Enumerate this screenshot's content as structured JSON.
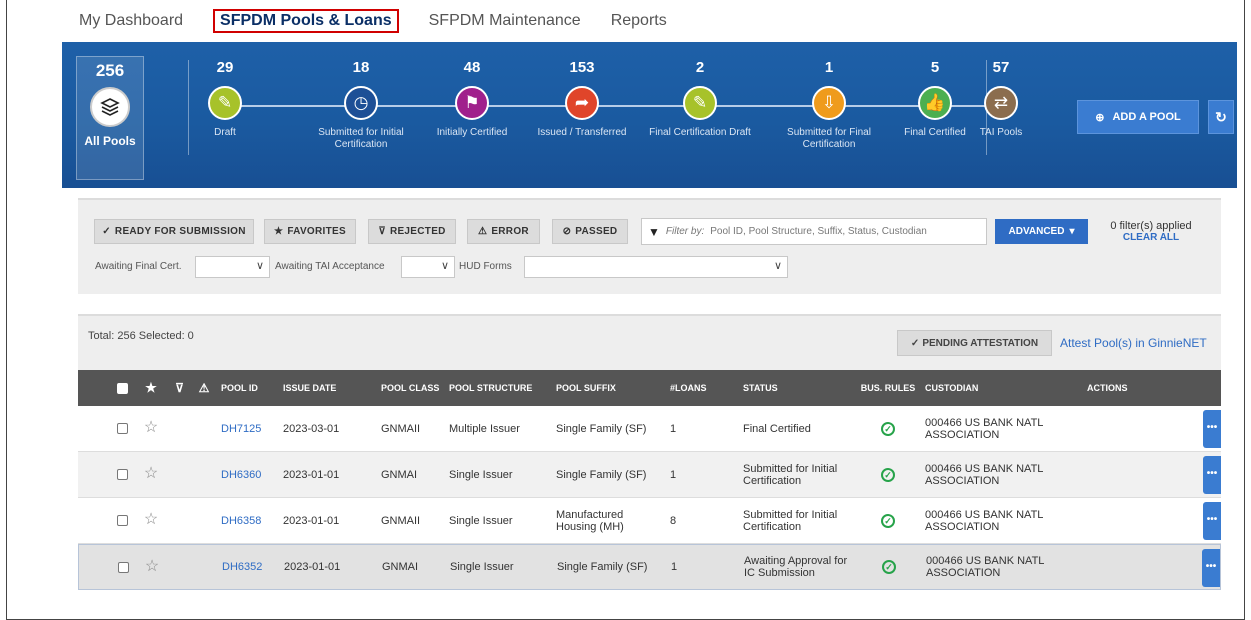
{
  "nav": {
    "tabs": [
      {
        "label": "My Dashboard"
      },
      {
        "label": "SFPDM Pools & Loans",
        "active": true
      },
      {
        "label": "SFPDM Maintenance"
      },
      {
        "label": "Reports"
      }
    ]
  },
  "strip": {
    "all": {
      "count": "256",
      "label": "All Pools"
    },
    "steps": [
      {
        "count": "29",
        "label": "Draft",
        "icon": "edit-icon",
        "color": "#a7c22a"
      },
      {
        "count": "18",
        "label": "Submitted for Initial Certification",
        "icon": "clock-icon",
        "color": "#1d4f96"
      },
      {
        "count": "48",
        "label": "Initially Certified",
        "icon": "flag-icon",
        "color": "#a0208c"
      },
      {
        "count": "153",
        "label": "Issued / Transferred",
        "icon": "share-icon",
        "color": "#e0452a"
      },
      {
        "count": "2",
        "label": "Final Certification Draft",
        "icon": "edit-icon",
        "color": "#a7c22a"
      },
      {
        "count": "1",
        "label": "Submitted for Final Certification",
        "icon": "inbox-icon",
        "color": "#ef9b1c"
      },
      {
        "count": "5",
        "label": "Final Certified",
        "icon": "thumbs-up-icon",
        "color": "#4caf50"
      },
      {
        "count": "57",
        "label": "TAI Pools",
        "icon": "transfer-icon",
        "color": "#8b6d4e"
      }
    ],
    "add_pool_label": "ADD A POOL"
  },
  "filters": {
    "buttons": [
      "READY FOR SUBMISSION",
      "FAVORITES",
      "REJECTED",
      "ERROR",
      "PASSED"
    ],
    "search_prefix": "Filter by:",
    "search_placeholder": "Pool ID, Pool Structure, Suffix, Status, Custodian",
    "advanced_label": "ADVANCED",
    "applied_text": "0 filter(s) applied",
    "clear_all": "CLEAR ALL",
    "awaiting_final_cert": "Awaiting Final Cert.",
    "awaiting_tai": "Awaiting TAI Acceptance",
    "hud_forms": "HUD Forms"
  },
  "summary": {
    "total_text": "Total: 256 Selected: 0",
    "pending_attestation": "PENDING ATTESTATION",
    "attest_link": "Attest Pool(s) in GinnieNET"
  },
  "table": {
    "headers": {
      "pool_id": "POOL ID",
      "issue_date": "ISSUE DATE",
      "pool_class": "POOL CLASS",
      "pool_structure": "POOL STRUCTURE",
      "pool_suffix": "POOL SUFFIX",
      "loans": "#LOANS",
      "status": "STATUS",
      "bus_rules": "BUS. RULES",
      "custodian": "CUSTODIAN",
      "actions": "ACTIONS"
    },
    "rows": [
      {
        "pool_id": "DH7125",
        "issue_date": "2023-03-01",
        "pool_class": "GNMAII",
        "pool_structure": "Multiple Issuer",
        "pool_suffix": "Single Family (SF)",
        "loans": "1",
        "status": "Final Certified",
        "custodian": "000466 US BANK NATL ASSOCIATION"
      },
      {
        "pool_id": "DH6360",
        "issue_date": "2023-01-01",
        "pool_class": "GNMAI",
        "pool_structure": "Single Issuer",
        "pool_suffix": "Single Family (SF)",
        "loans": "1",
        "status": "Submitted for Initial Certification",
        "custodian": "000466 US BANK NATL ASSOCIATION"
      },
      {
        "pool_id": "DH6358",
        "issue_date": "2023-01-01",
        "pool_class": "GNMAII",
        "pool_structure": "Single Issuer",
        "pool_suffix": "Manufactured Housing (MH)",
        "loans": "8",
        "status": "Submitted for Initial Certification",
        "custodian": "000466 US BANK NATL ASSOCIATION"
      },
      {
        "pool_id": "DH6352",
        "issue_date": "2023-01-01",
        "pool_class": "GNMAI",
        "pool_structure": "Single Issuer",
        "pool_suffix": "Single Family (SF)",
        "loans": "1",
        "status": "Awaiting Approval for IC Submission",
        "custodian": "000466 US BANK NATL ASSOCIATION"
      }
    ]
  }
}
